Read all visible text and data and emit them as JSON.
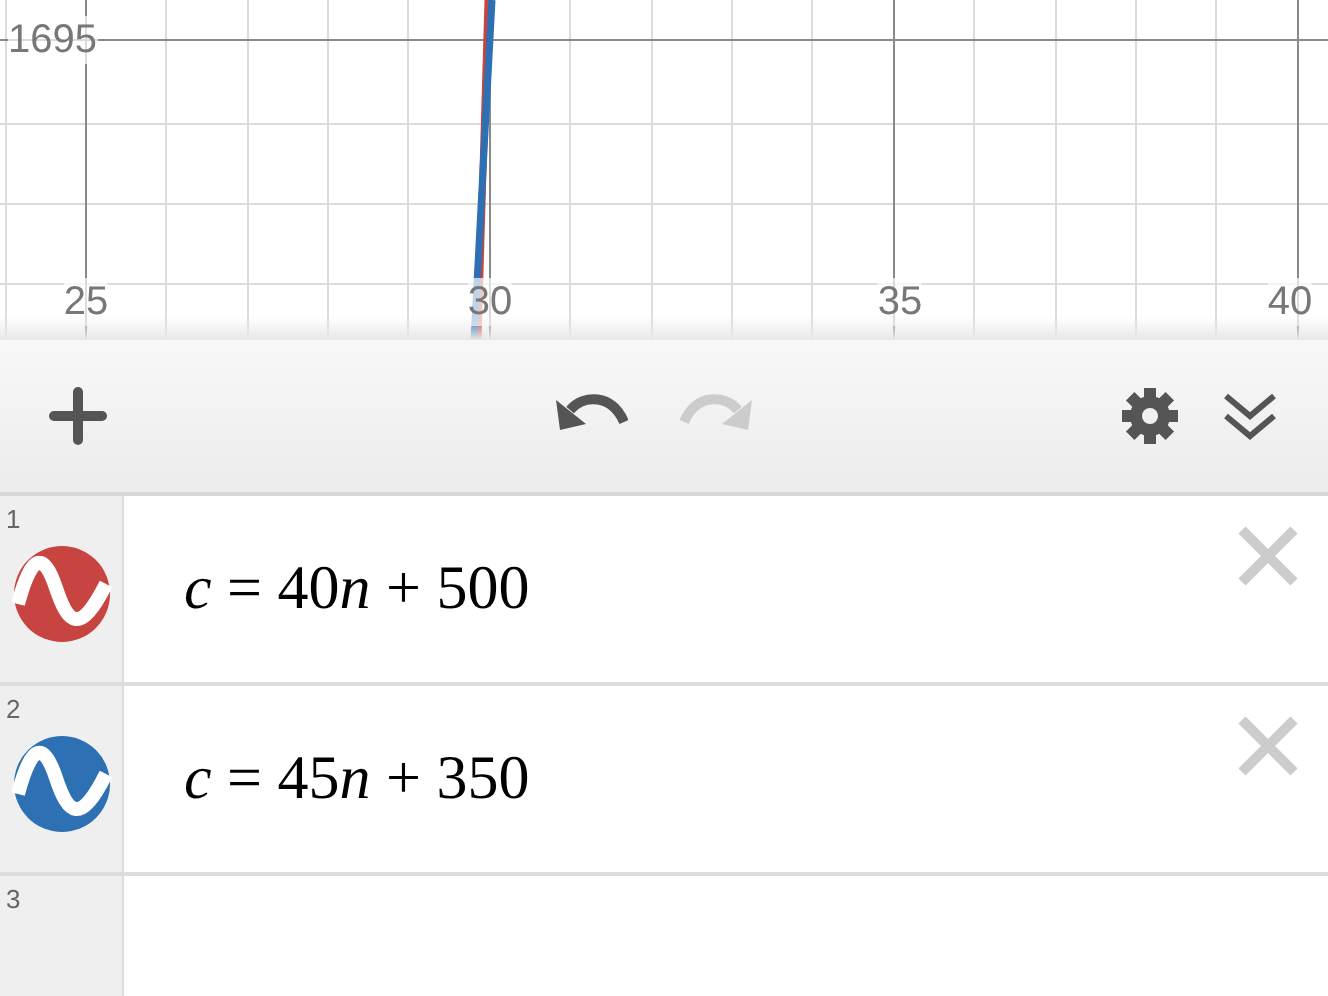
{
  "graph": {
    "x_tick_labels": [
      "25",
      "30",
      "35",
      "40"
    ],
    "y_tick_labels": [
      "1695"
    ]
  },
  "toolbar": {
    "undo": {
      "disabled": false
    },
    "redo": {
      "disabled": true
    }
  },
  "expressions": [
    {
      "number": "1",
      "formula": [
        {
          "text": "c",
          "italic": true
        },
        {
          "text": " = 40",
          "italic": false
        },
        {
          "text": "n",
          "italic": true
        },
        {
          "text": " + 500",
          "italic": false
        }
      ],
      "color": "#c74440"
    },
    {
      "number": "2",
      "formula": [
        {
          "text": "c",
          "italic": true
        },
        {
          "text": " = 45",
          "italic": false
        },
        {
          "text": "n",
          "italic": true
        },
        {
          "text": " + 350",
          "italic": false
        }
      ],
      "color": "#2d70b3"
    },
    {
      "number": "3"
    }
  ]
}
